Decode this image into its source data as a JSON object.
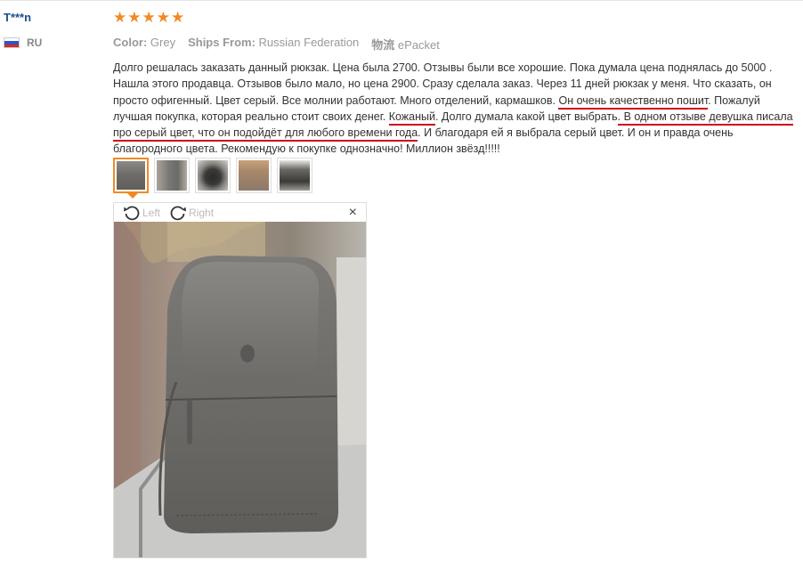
{
  "user": {
    "name": "T***n",
    "country": "RU"
  },
  "review": {
    "stars": 5,
    "meta": {
      "color_label": "Color:",
      "color_value": "Grey",
      "ships_label": "Ships From:",
      "ships_value": "Russian Federation",
      "shipping_label": "物流",
      "shipping_value": "ePacket"
    },
    "segments": [
      {
        "text": "Долго решалась заказать данный рюкзак. Цена была 2700. Отзывы были все хорошие. Пока думала цена поднялась до 5000 . Нашла этого продавца. Отзывов было мало, но цена 2900. Сразу сделала заказ. Через 11 дней рюкзак у меня. Что сказать, он просто офигенный. Цвет серый. Все молнии работают. Много отделений, кармашков. ",
        "u": false
      },
      {
        "text": "Он очень качественно пошит",
        "u": true
      },
      {
        "text": ". Пожалуй лучшая покупка, которая реально стоит своих денег. ",
        "u": false
      },
      {
        "text": "Кожаный",
        "u": true
      },
      {
        "text": ". Долго думала какой цвет выбрать",
        "u": false
      },
      {
        "text": ". В одном отзыве девушка писала про серый цвет, что он подойдёт для любого времени года",
        "u": true
      },
      {
        "text": ". И благодаря ей я выбрала серый цвет. И он и правда очень благородного цвета. Рекомендую к покупке однозначно! Миллион звёзд!!!!!",
        "u": false
      }
    ]
  },
  "viewer": {
    "left_label": "Left",
    "right_label": "Right",
    "close_symbol": "×"
  },
  "colors": {
    "underline": "#d0021b",
    "star": "#f08a24",
    "username": "#1d4d8f"
  }
}
